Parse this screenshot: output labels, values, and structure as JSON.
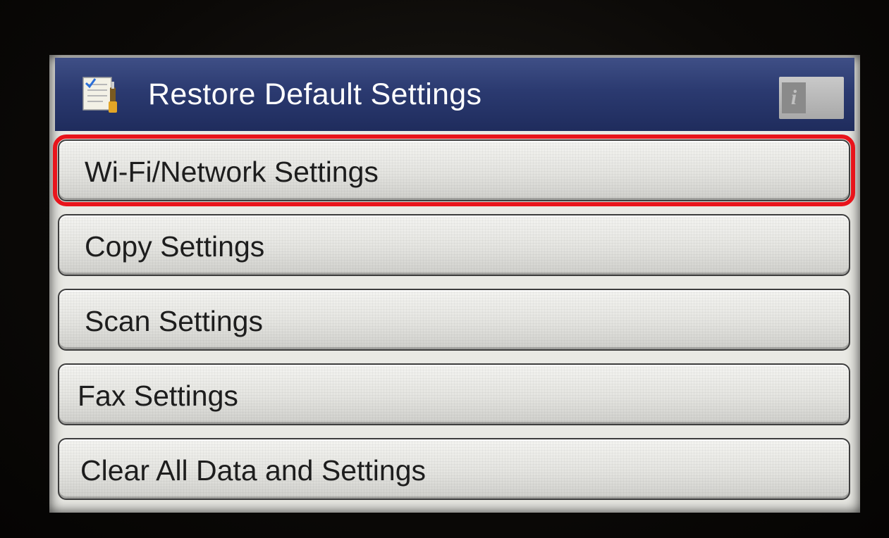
{
  "header": {
    "title": "Restore Default Settings",
    "icon": "settings-checklist-icon",
    "info_label": "i",
    "info_icon": "info-icon"
  },
  "menu": {
    "items": [
      {
        "label": "Wi-Fi/Network Settings",
        "selected": true
      },
      {
        "label": "Copy Settings",
        "selected": false
      },
      {
        "label": "Scan Settings",
        "selected": false
      },
      {
        "label": "Fax Settings",
        "selected": false
      },
      {
        "label": "Clear All Data and Settings",
        "selected": false
      }
    ]
  },
  "colors": {
    "header_bg": "#2b3a70",
    "selection_outline": "#e8141b",
    "button_bg": "#e4e4e0"
  }
}
